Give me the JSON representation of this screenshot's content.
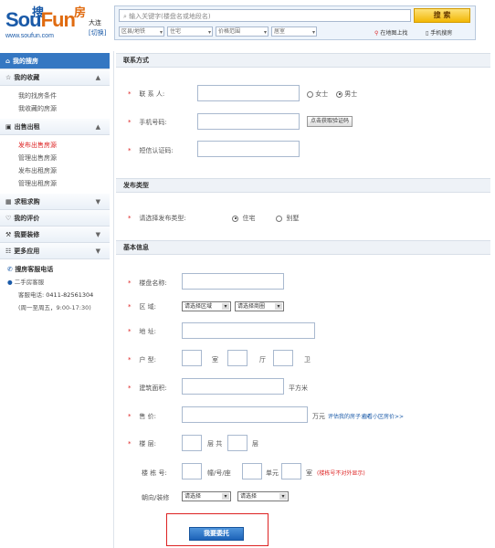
{
  "header": {
    "logo_cn_1": "搜",
    "logo_cn_2": "房",
    "logo_en_so": "Sou",
    "logo_en_fun": "Fun",
    "logo_url": "www.soufun.com",
    "city": "大连",
    "city_switch": "[切换]",
    "search_placeholder": "输入关键字(楼盘名或地段名)",
    "search_button": "搜 索",
    "filters": [
      "区县/地铁",
      "住宅",
      "价格范围",
      "居室"
    ],
    "map_link": "在地图上找",
    "mobile_link": "手机搜房"
  },
  "sidebar": {
    "my_search": "我的搜房",
    "my_favorites": "我的收藏",
    "favorites_items": [
      "我的找房条件",
      "我收藏的房源"
    ],
    "sell_rent": "出售出租",
    "sell_rent_items": [
      "发布出售房源",
      "管理出售房源",
      "发布出租房源",
      "管理出租房源"
    ],
    "seek_buy": "求租求购",
    "my_reviews": "我的评价",
    "renovation": "我要装修",
    "more_apps": "更多应用",
    "hotline_title": "搜房客服电话",
    "hotline_type": "二手房客服",
    "hotline_phone_label": "客服电话:",
    "hotline_phone": "0411-82561304",
    "hotline_hours": "(周一至周五，9:00-17:30)"
  },
  "contact": {
    "section_title": "联系方式",
    "name_label": "联 系 人:",
    "gender_female": "女士",
    "gender_male": "男士",
    "phone_label": "手机号码:",
    "get_code_button": "点击获取验证码",
    "sms_label": "短信认证码:"
  },
  "publish_type": {
    "section_title": "发布类型",
    "label": "请选择发布类型:",
    "option_residence": "住宅",
    "option_villa": "别墅"
  },
  "basic_info": {
    "section_title": "基本信息",
    "estate_label": "楼盘名称:",
    "district_label": "区  域:",
    "district_select": "请选择区域",
    "area_select": "请选择商圈",
    "address_label": "地  址:",
    "layout_label": "户  型:",
    "layout_room": "室",
    "layout_hall": "厅",
    "layout_bath": "卫",
    "building_area_label": "建筑面积:",
    "area_unit": "平方米",
    "price_label": "售  价:",
    "price_unit": "万元",
    "price_link_1": "评估我的房子>>",
    "price_link_2": "查看小区房价>>",
    "floor_label": "楼  层:",
    "floor_level": "层 共",
    "floor_total": "层",
    "building_no_label": "楼 栋 号:",
    "building_unit_text": "幢/号/座",
    "unit_text": "单元",
    "room_text": "室",
    "building_hint": "(楼栋号不对外显示)",
    "orientation_label": "朝向/装修",
    "orientation_select": "请选择",
    "decoration_select": "请选择",
    "submit_button": "我要委托"
  },
  "colors": {
    "accent_blue": "#3577c2",
    "required_red": "#d22",
    "link_blue": "#1a5aa8",
    "search_yellow": "#f2b705"
  }
}
